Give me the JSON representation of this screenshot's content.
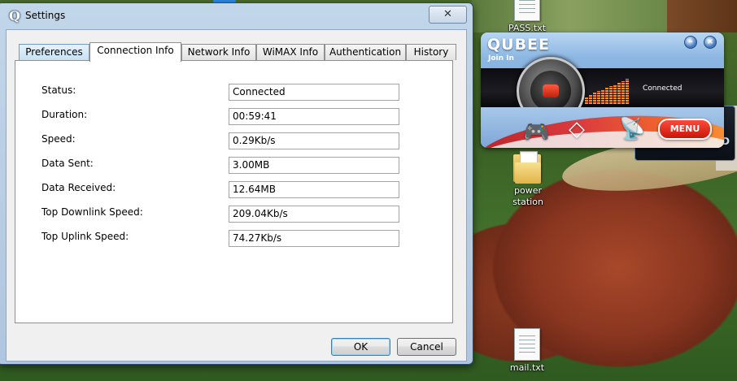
{
  "desktop": {
    "icons": [
      {
        "label": "PASS.txt",
        "icon": "text-file-icon"
      },
      {
        "label": "power station",
        "icon": "folder-icon"
      },
      {
        "label": "mail.txt",
        "icon": "text-file-icon"
      }
    ]
  },
  "qubee": {
    "logo": "QUBEE",
    "tagline": "Join In",
    "status": "Connected",
    "menu_label": "MENU",
    "minimize_glyph": "–",
    "close_glyph": "×",
    "side_panel_letter": "D",
    "accent": "#e8301c"
  },
  "dialog": {
    "title": "Settings",
    "app_icon_glyph": "Q",
    "close_glyph": "✕",
    "tabs": [
      {
        "label": "Preferences"
      },
      {
        "label": "Connection Info"
      },
      {
        "label": "Network Info"
      },
      {
        "label": "WiMAX Info"
      },
      {
        "label": "Authentication"
      },
      {
        "label": "History"
      }
    ],
    "active_tab": "Connection Info",
    "fields": [
      {
        "label": "Status:",
        "value": "Connected"
      },
      {
        "label": "Duration:",
        "value": "00:59:41"
      },
      {
        "label": "Speed:",
        "value": "0.29Kb/s"
      },
      {
        "label": "Data Sent:",
        "value": "3.00MB"
      },
      {
        "label": "Data Received:",
        "value": "12.64MB"
      },
      {
        "label": "Top Downlink Speed:",
        "value": "209.04Kb/s"
      },
      {
        "label": "Top Uplink Speed:",
        "value": "74.27Kb/s"
      }
    ],
    "ok_label": "OK",
    "cancel_label": "Cancel"
  }
}
